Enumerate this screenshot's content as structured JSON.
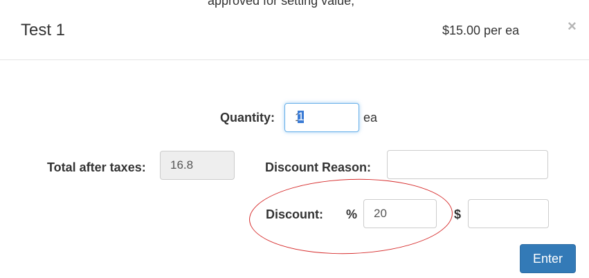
{
  "header": {
    "top_cut_text": "approved for setting value,",
    "title": "Test 1",
    "price": "$15.00 per ea",
    "close_symbol": "×"
  },
  "form": {
    "quantity_label": "Quantity:",
    "quantity_value": "1",
    "quantity_unit": "ea",
    "total_label": "Total after taxes:",
    "total_value": "16.8",
    "discount_reason_label": "Discount Reason:",
    "discount_reason_value": "",
    "discount_label": "Discount:",
    "percent_symbol": "%",
    "discount_percent_value": "20",
    "dollar_symbol": "$",
    "discount_amount_value": ""
  },
  "footer": {
    "enter_label": "Enter"
  },
  "colors": {
    "primary": "#337ab7",
    "annotation": "#d62b2b",
    "focus": "#66afe9"
  }
}
